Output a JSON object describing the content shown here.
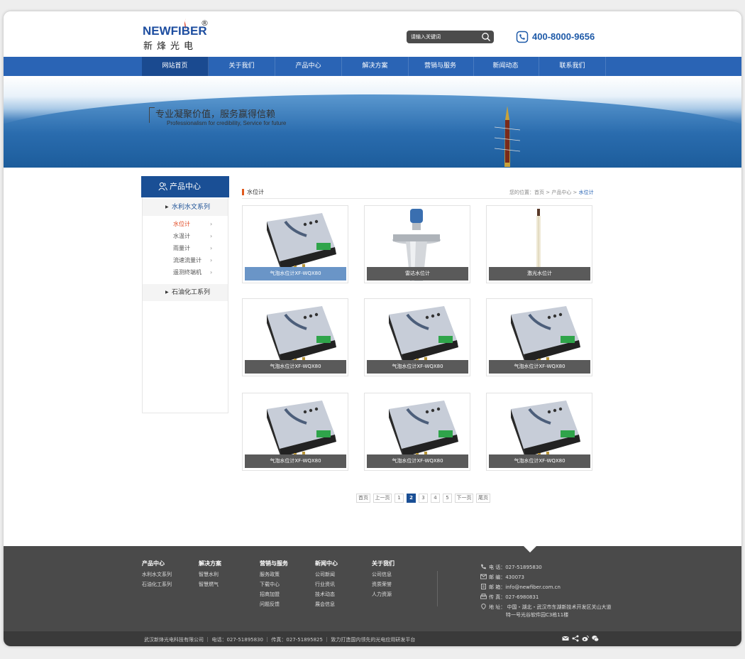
{
  "brand": {
    "logo_en": "NEWFIBER",
    "logo_reg": "®",
    "logo_cn": "新烽光电"
  },
  "search": {
    "placeholder": "请输入关键词"
  },
  "phone": "400-8000-9656",
  "nav": [
    "网站首页",
    "关于我们",
    "产品中心",
    "解决方案",
    "营销与服务",
    "新闻动态",
    "联系我们"
  ],
  "banner": {
    "slogan_cn": "专业凝聚价值，服务赢得信赖",
    "slogan_en": "Professionalism for credibility, Service for future"
  },
  "sidebar": {
    "title": "产品中心",
    "categories": [
      {
        "label": "水利水文系列",
        "sub": [
          "水位计",
          "水温计",
          "雨量计",
          "流速流量计",
          "遥测终端机"
        ]
      },
      {
        "label": "石油化工系列"
      }
    ]
  },
  "content": {
    "title": "水位计",
    "breadcrumb": {
      "prefix": "您的位置：",
      "home": "首页",
      "sep": " > ",
      "section": "产品中心",
      "current": "水位计"
    },
    "products": [
      "气泡水位计XF-WQX80",
      "雷达水位计",
      "激光水位计",
      "气泡水位计XF-WQX80",
      "气泡水位计XF-WQX80",
      "气泡水位计XF-WQX80",
      "气泡水位计XF-WQX80",
      "气泡水位计XF-WQX80",
      "气泡水位计XF-WQX80"
    ]
  },
  "pager": {
    "first": "首页",
    "prev": "上一页",
    "pages": [
      "1",
      "2",
      "3",
      "4",
      "5"
    ],
    "next": "下一页",
    "last": "尾页",
    "current": 2
  },
  "footer": {
    "columns": [
      {
        "head": "产品中心",
        "links": [
          "水利水文系列",
          "石油化工系列"
        ]
      },
      {
        "head": "解决方案",
        "links": [
          "智慧水利",
          "智慧燃气"
        ]
      },
      {
        "head": "营销与服务",
        "links": [
          "服务政策",
          "下载中心",
          "招商加盟",
          "问题反馈"
        ]
      },
      {
        "head": "新闻中心",
        "links": [
          "公司新闻",
          "行业资讯",
          "技术动态",
          "展会信息"
        ]
      },
      {
        "head": "关于我们",
        "links": [
          "公司信息",
          "资质荣誉",
          "人力资源"
        ]
      }
    ],
    "contact": {
      "tel": "电 话：027-51895830",
      "zip": "邮 编：430073",
      "email": "邮 箱：info@newfiber.com.cn",
      "fax": "传 真：027-6980831",
      "addr1": "地 址： 中国・湖北・武汉市东湖新技术开发区关山大道",
      "addr2": "特一号光谷软件园C3栋11楼"
    },
    "bottom": "武汉新烽光电科技有限公司  ｜ 电话：027-51895830  ｜ 传真：027-51895825  ｜  致力打造国内领先的光电应用研发平台"
  },
  "colors": {
    "nav": "#2a64b5",
    "nav_active": "#1a4a90",
    "sidebar_title": "#1a4f95",
    "accent": "#e05a1e",
    "footer": "#4a4a4a"
  }
}
